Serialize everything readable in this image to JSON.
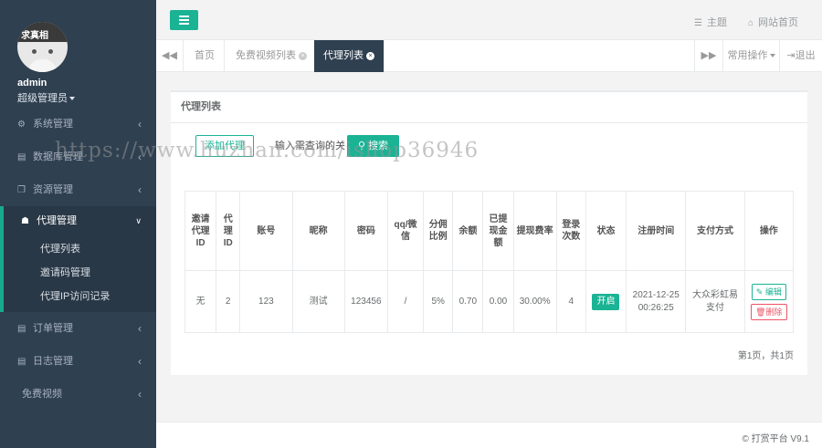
{
  "user": {
    "name": "admin",
    "role": "超级管理员",
    "avatar_text": "求真相"
  },
  "sidebar": {
    "items": [
      {
        "label": "系统管理",
        "icon": "gear-icon",
        "glyph": "⚙"
      },
      {
        "label": "数据库管理",
        "icon": "database-icon",
        "glyph": "▤"
      },
      {
        "label": "资源管理",
        "icon": "copy-icon",
        "glyph": "❐"
      },
      {
        "label": "代理管理",
        "icon": "users-icon",
        "glyph": "👥"
      },
      {
        "label": "订单管理",
        "icon": "list-icon",
        "glyph": "▤"
      },
      {
        "label": "日志管理",
        "icon": "log-icon",
        "glyph": "▤"
      },
      {
        "label": "免费视频"
      }
    ],
    "submenu": [
      "代理列表",
      "邀请码管理",
      "代理IP访问记录"
    ]
  },
  "header": {
    "theme": "主题",
    "site_home": "网站首页"
  },
  "tabs": {
    "items": [
      "首页",
      "免费视频列表",
      "代理列表"
    ],
    "common_ops": "常用操作",
    "logout": "退出"
  },
  "main": {
    "title": "代理列表",
    "add_button": "添加代理",
    "search_placeholder": "输入需查询的关",
    "search_button": "搜索",
    "columns": [
      "邀请代理ID",
      "代理ID",
      "账号",
      "昵称",
      "密码",
      "qq/微信",
      "分佣比例",
      "余额",
      "已提现金额",
      "提现费率",
      "登录次数",
      "状态",
      "注册时间",
      "支付方式",
      "操作"
    ],
    "rows": [
      {
        "inviter": "无",
        "agent_id": "2",
        "account": "123",
        "nickname": "测试",
        "password": "123456",
        "qq": "/",
        "commission": "5%",
        "balance": "0.70",
        "withdrawn": "0.00",
        "fee_rate": "30.00%",
        "logins": "4",
        "status": "开启",
        "reg_time": "2021-12-25 00:26:25",
        "pay_method": "大众彩虹易支付",
        "edit": "编辑",
        "delete": "删除"
      }
    ],
    "pager": "第1页，共1页"
  },
  "footer": {
    "text": "© 打赏平台 V9.1"
  },
  "watermark": "https://www.huzhan.com/ishop36946",
  "colors": {
    "accent": "#1ab394",
    "sidebar": "#2f4050",
    "danger": "#ed5565"
  }
}
